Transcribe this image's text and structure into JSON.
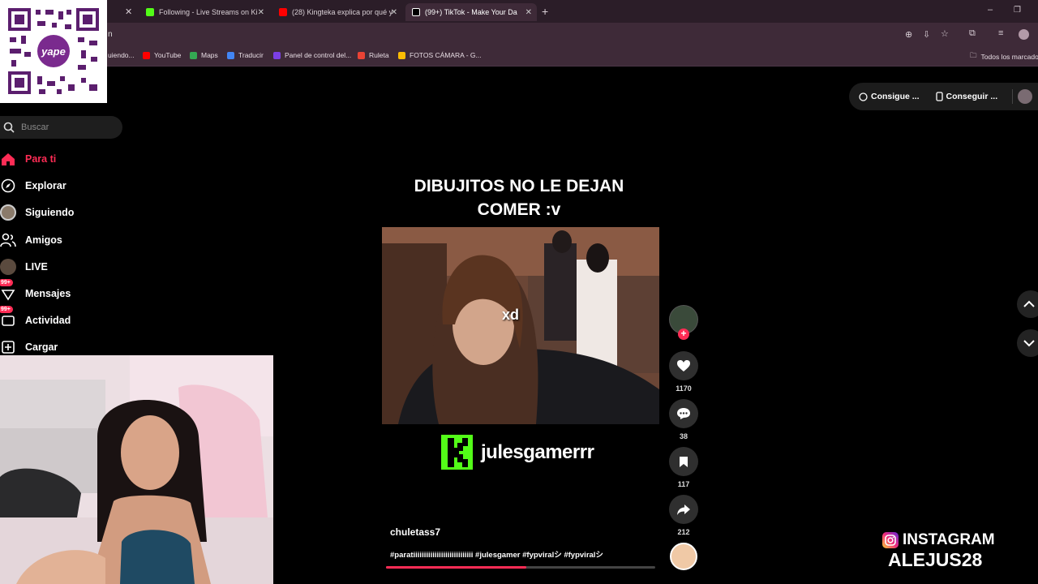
{
  "browser": {
    "tabs": [
      {
        "label": "Following - Live Streams on Ki",
        "icon": "kick-icon"
      },
      {
        "label": "(28) Kingteka explica por qué y",
        "icon": "youtube-icon"
      },
      {
        "label": "(99+) TikTok - Make Your Da",
        "icon": "tiktok-icon"
      }
    ],
    "address_partial": "n",
    "bookmarks": [
      {
        "label": "uiendo...",
        "color": "#888888"
      },
      {
        "label": "YouTube",
        "color": "#ff0000"
      },
      {
        "label": "Maps",
        "color": "#34a853"
      },
      {
        "label": "Traducir",
        "color": "#4285f4"
      },
      {
        "label": "Panel de control del...",
        "color": "#7b3fe4"
      },
      {
        "label": "Ruleta",
        "color": "#ea4335"
      },
      {
        "label": "FOTOS CÁMARA - G...",
        "color": "#fbbc04"
      }
    ],
    "all_bookmarks": "Todos los marcado"
  },
  "qr_overlay": {
    "brand": "yape"
  },
  "sidebar": {
    "search_placeholder": "Buscar",
    "items": [
      {
        "label": "Para ti",
        "icon": "home-icon",
        "active": true
      },
      {
        "label": "Explorar",
        "icon": "compass-icon"
      },
      {
        "label": "Siguiendo",
        "icon": "following-avatar-icon"
      },
      {
        "label": "Amigos",
        "icon": "friends-icon"
      },
      {
        "label": "LIVE",
        "icon": "live-avatar-icon"
      },
      {
        "label": "Mensajes",
        "icon": "messages-icon",
        "badge": "99+"
      },
      {
        "label": "Actividad",
        "icon": "activity-icon",
        "badge": "99+"
      },
      {
        "label": "Cargar",
        "icon": "upload-icon"
      }
    ]
  },
  "top_buttons": {
    "coins_label": "Consigue ...",
    "app_label": "Conseguir ..."
  },
  "video": {
    "caption": "DIBUJITOS NO LE DEJAN COMER :v",
    "overlay_text": "xd",
    "watermark": "julesgamerrr",
    "author": "chuletass7",
    "hashtags": "#paratiiiiiiiiiiiiiiiiiiiiiiiiiiii #julesgamer #fypviralシ #fypviralシ",
    "progress": 0.52
  },
  "actions": {
    "likes": "1170",
    "comments": "38",
    "saves": "117",
    "shares": "212"
  },
  "overlay": {
    "instagram_label": "INSTAGRAM",
    "instagram_handle": "ALEJUS28"
  },
  "colors": {
    "tiktok_red": "#fe2c55",
    "kick_green": "#53fc18",
    "chrome_bg": "#3e2a38"
  }
}
